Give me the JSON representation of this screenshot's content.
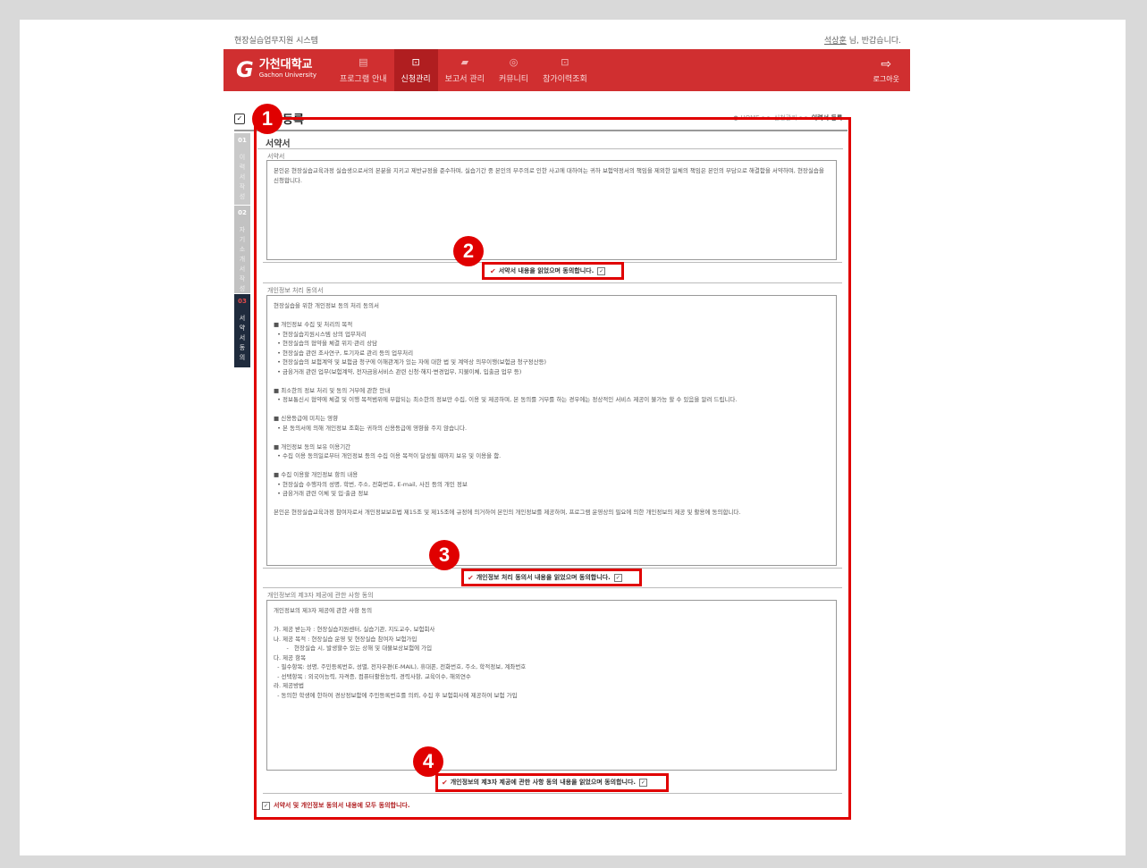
{
  "top": {
    "system_name": "현장실습업무지원 시스템",
    "user_name": "석상훈",
    "greeting": " 님, 반갑습니다."
  },
  "header": {
    "logo_mark": "G",
    "logo_korean": "가천대학교",
    "logo_english": "Gachon University",
    "nav": [
      {
        "label": "프로그램 안내",
        "icon": "document-icon",
        "glyph": "▤",
        "active": false
      },
      {
        "label": "신청관리",
        "icon": "search-doc-icon",
        "glyph": "⊡",
        "active": true
      },
      {
        "label": "보고서 관리",
        "icon": "folder-icon",
        "glyph": "▰",
        "active": false
      },
      {
        "label": "커뮤니티",
        "icon": "community-icon",
        "glyph": "◎",
        "active": false
      },
      {
        "label": "참가이력조회",
        "icon": "history-icon",
        "glyph": "⊡",
        "active": false
      }
    ],
    "logout_label": "로그아웃",
    "logout_glyph": "⇨"
  },
  "page": {
    "title": "등록",
    "icon_glyph": "✓",
    "breadcrumb_prefix": "● HOME >> 신청관리 >> ",
    "breadcrumb_current": "이력서 등록"
  },
  "steps": [
    {
      "num": "01",
      "label": "이\n력\n서\n작\n성"
    },
    {
      "num": "02",
      "label": "자\n기\n소\n개\n서\n작\n성"
    },
    {
      "num": "03",
      "label": "서\n약\n서\n동\n의"
    }
  ],
  "section_title": "서약서",
  "pledge": {
    "label": "서약서",
    "text": "본인은 현장실습교육과정 실습생으로서의 본분을 지키고 제반규정을 준수하며, 실습기간 중 본인의 부주의로 인한 사고에 대하여는 귀하 보험약정서의 책임을 제외한 일체의 책임은 본인의 부담으로 해결함을 서약하며, 현장실습을 신청합니다.",
    "agree_label": "서약서 내용을 읽었으며 동의합니다."
  },
  "privacy": {
    "label": "개인정보 처리 동의서",
    "text": "현장실습을 위한 개인정보 동의 처리 동의서\n\n■ 개인정보 수집 및 처리의 목적\n  • 현장실습지원시스템 상의 업무처리\n  • 현장실습의 협약을 체결 위지·관리 상담\n  • 현장실습 관련 조사연구, 토기자료 관리 등의 업무처리\n  • 현장실습의 보험계약 및 보험금 청구에 이해관계가 있는 자에 대한 법 및 계약상 의무이행(보험금 청구정산등)\n  • 금융거래 관련 업무(보험계약, 전자금융서비스 관련 신청·해지·변경업무, 지불이체, 입출금 업무 등)\n\n■ 최소한의 정보 처리 및 동의 거부에 관한 안내\n  • 정보통신시 협약에 체결 및 이행 목적범위에 부합되는 최소한의 정보만 수집, 이용 및 제공하며, 본 동의를 거부를 하는 경우에는 정상적인 서비스 제공이 불가능 할 수 있음을 알려 드립니다.\n\n■ 신용등급에 미치는 영향\n  • 본 동의서에 의해 개인정보 조회는 귀하의 신용등급에 영향을 주지 않습니다.\n\n■ 개인정보 동의 보유 이용기간\n  • 수집 이용 동의일로부터 개인정보 등의 수집 이용 목적이 달성될 때까지 보유 및 이용을 함.\n\n■ 수집 이용할 개인정보 항의 내용\n  • 현장실습 수행자의 성명, 학번, 주소, 전화번호, E-mail, 사진 등의 개인 정보\n  • 금융거래 관련 이체 및 입·출금 정보\n\n본인은 현장실습교육과정 참여자로서 개인정보보호법 제15조 및 제15조에 규정에 의거하여 본인의 개인정보를 제공하며, 프로그램 운영상의 필요에 의한 개인정보의 제공 및 활용에 동의합니다.",
    "agree_label": "개인정보 처리 동의서 내용을 읽었으며 동의합니다."
  },
  "third_party": {
    "label": "개인정보의 제3자 제공에 관한 사항 동의",
    "text": "개인정보의 제3자 제공에 관한 사항 동의\n\n가. 제공 받는자 : 현장실습지원센터, 실습기관, 지도교수, 보험회사\n나. 제공 목적 : 현장실습 운영 및 현장실습 참여자 보험가입\n       -   현장실습 시, 발생할수 있는 상해 및 대물보상보험에 가입\n다. 제공 항목\n  - 필수항목: 성명, 주민등록번호, 성별, 전자우편(E-MAIL), 휴대폰, 전화번호, 주소, 학적정보, 계좌번호\n  - 선택항목 : 외국어능력, 자격증, 컴퓨터활용능력, 경력사항, 교육이수, 해외연수\n라. 제공방법\n  - 동의한 학생에 한하여 경상정보함에 주민등록번호를 의뢰, 수집 후 보험회사에 제공하여 보험 가입",
    "agree_label": "개인정보의 제3자 제공에 관한 사항 동의 내용을 읽었으며 동의합니다."
  },
  "all_agree_label": "서약서 및 개인정보 동의서 내용에 모두 동의합니다.",
  "check_glyph": "✔",
  "box_glyph": "✓",
  "callouts": [
    "1",
    "2",
    "3",
    "4"
  ],
  "colors": {
    "header": "#d02f30",
    "active_nav": "#b01e20",
    "highlight": "#e00000",
    "step_active": "#1f2b3d"
  }
}
